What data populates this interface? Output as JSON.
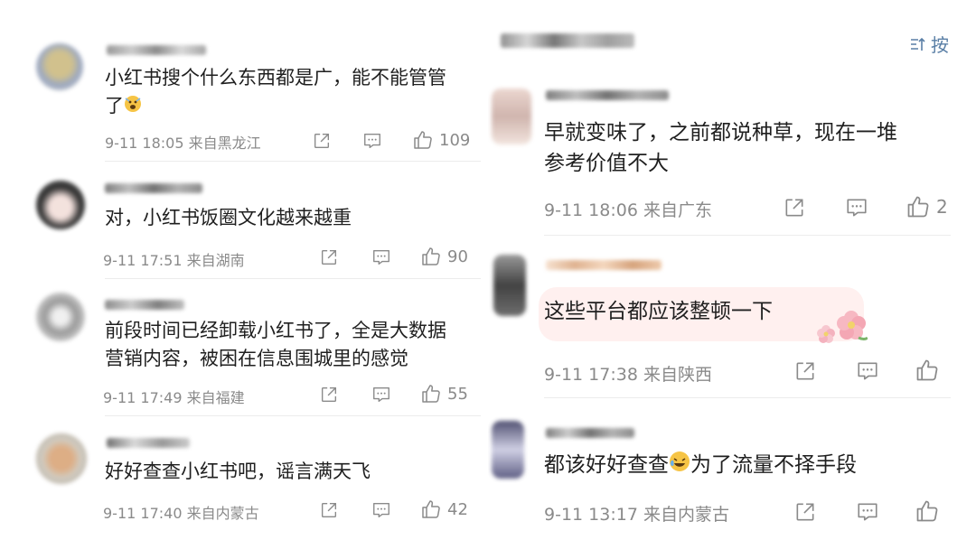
{
  "left": {
    "comments": [
      {
        "text1": "小红书搜个什么东西都是广，能不能管管",
        "text2": "了",
        "time": "9-11 18:05",
        "location": "来自黑龙江",
        "likes": "109"
      },
      {
        "text1": "对，小红书饭圈文化越来越重",
        "time": "9-11 17:51",
        "location": "来自湖南",
        "likes": "90"
      },
      {
        "text1": "前段时间已经卸载小红书了，全是大数据",
        "text2": "营销内容，被困在信息围城里的感觉",
        "time": "9-11 17:49",
        "location": "来自福建",
        "likes": "55"
      },
      {
        "text1": "好好查查小红书吧，谣言满天飞",
        "time": "9-11 17:40",
        "location": "来自内蒙古",
        "likes": "42"
      }
    ]
  },
  "right": {
    "sort_label": "按",
    "comments": [
      {
        "text1": "早就变味了，之前都说种草，现在一堆",
        "text2": "参考价值不大",
        "time": "9-11 18:06",
        "location": "来自广东",
        "likes": "2"
      },
      {
        "text1": "这些平台都应该整顿一下",
        "time": "9-11 17:38",
        "location": "来自陕西"
      },
      {
        "text1a": "都该好好查查",
        "text1b": "为了流量不择手段",
        "time": "9-11 13:17",
        "location": "来自内蒙古"
      }
    ]
  },
  "colors": {
    "text": "#1f1f1f",
    "meta": "#8a8a8a",
    "sort": "#5a7fa6",
    "highlight": "#fff0ef"
  }
}
